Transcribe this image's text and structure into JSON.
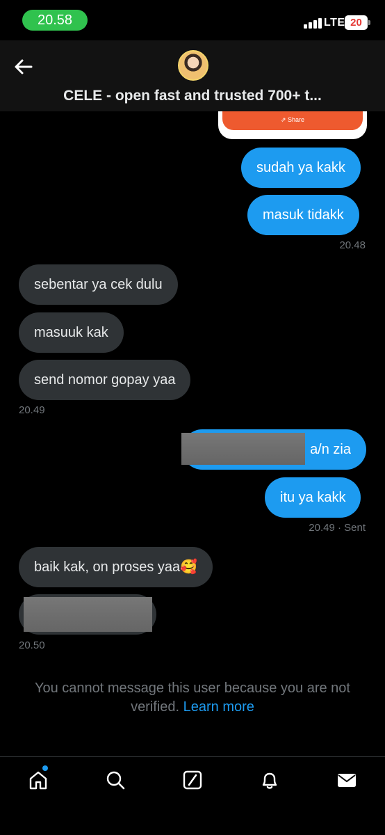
{
  "status_bar": {
    "time": "20.58",
    "network": "LTE",
    "battery": "20"
  },
  "header": {
    "title": "CELE - open fast and trusted 700+ t..."
  },
  "previous_card": {
    "share_label": "Share"
  },
  "messages": [
    {
      "direction": "out",
      "text": "sudah ya kakk"
    },
    {
      "direction": "out",
      "text": "masuk tidakk"
    },
    {
      "direction": "in",
      "text": "sebentar ya cek dulu"
    },
    {
      "direction": "in",
      "text": "masuuk kak"
    },
    {
      "direction": "in",
      "text": "send nomor gopay yaa"
    },
    {
      "direction": "out",
      "text": "a/n zia"
    },
    {
      "direction": "out",
      "text": "itu ya kakk"
    },
    {
      "direction": "in",
      "text": "baik kak, on proses yaa🥰"
    }
  ],
  "timestamps": {
    "t1": "20.48",
    "t2": "20.49",
    "t3": "20.49 · Sent",
    "t4": "20.50"
  },
  "notice": {
    "text": "You cannot message this user because you are not verified.",
    "link": "Learn more"
  },
  "nav": {
    "items": [
      "home-icon",
      "search-icon",
      "grok-icon",
      "bell-icon",
      "mail-icon"
    ]
  },
  "colors": {
    "accent": "#1d9bf0",
    "incoming_bubble": "#2f3336",
    "time_pill": "#30c24e"
  }
}
